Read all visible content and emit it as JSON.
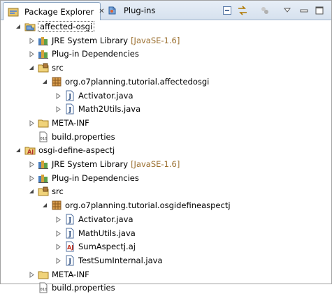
{
  "tabs": [
    {
      "label": "Package Explorer",
      "active": true,
      "close": "✕"
    },
    {
      "label": "Plug-ins",
      "active": false
    }
  ],
  "tree": [
    {
      "label": "affected-osgi",
      "icon": "plugin-project-icon",
      "level": 0,
      "expanded": true,
      "selected": true
    },
    {
      "label": "JRE System Library",
      "decoration": "[JavaSE-1.6]",
      "icon": "library-icon",
      "level": 1,
      "expanded": false
    },
    {
      "label": "Plug-in Dependencies",
      "icon": "library-icon",
      "level": 1,
      "expanded": false
    },
    {
      "label": "src",
      "icon": "source-folder-icon",
      "level": 1,
      "expanded": true
    },
    {
      "label": "org.o7planning.tutorial.affectedosgi",
      "icon": "package-icon",
      "level": 2,
      "expanded": true
    },
    {
      "label": "Activator.java",
      "icon": "java-file-icon",
      "level": 3,
      "expanded": false
    },
    {
      "label": "Math2Utils.java",
      "icon": "java-file-icon",
      "level": 3,
      "expanded": false
    },
    {
      "label": "META-INF",
      "icon": "folder-icon",
      "level": 1,
      "expanded": false
    },
    {
      "label": "build.properties",
      "icon": "properties-file-icon",
      "level": 1,
      "leaf": true
    },
    {
      "label": "osgi-define-aspectj",
      "icon": "aspectj-project-icon",
      "level": 0,
      "expanded": true
    },
    {
      "label": "JRE System Library",
      "decoration": "[JavaSE-1.6]",
      "icon": "library-icon",
      "level": 1,
      "expanded": false
    },
    {
      "label": "Plug-in Dependencies",
      "icon": "library-icon",
      "level": 1,
      "expanded": false
    },
    {
      "label": "src",
      "icon": "source-folder-icon",
      "level": 1,
      "expanded": true
    },
    {
      "label": "org.o7planning.tutorial.osgidefineaspectj",
      "icon": "package-icon",
      "level": 2,
      "expanded": true
    },
    {
      "label": "Activator.java",
      "icon": "java-file-icon",
      "level": 3,
      "expanded": false
    },
    {
      "label": "MathUtils.java",
      "icon": "java-file-icon",
      "level": 3,
      "expanded": false
    },
    {
      "label": "SumAspectj.aj",
      "icon": "aspectj-file-icon",
      "level": 3,
      "expanded": false
    },
    {
      "label": "TestSumInternal.java",
      "icon": "java-file-icon",
      "level": 3,
      "expanded": false
    },
    {
      "label": "META-INF",
      "icon": "folder-icon",
      "level": 1,
      "expanded": false
    },
    {
      "label": "build.properties",
      "icon": "properties-file-icon",
      "level": 1,
      "leaf": true
    }
  ],
  "toolbar": [
    "collapse-all-icon",
    "link-with-editor-icon",
    "filters-icon",
    "view-menu-icon",
    "minimize-icon",
    "maximize-icon"
  ]
}
